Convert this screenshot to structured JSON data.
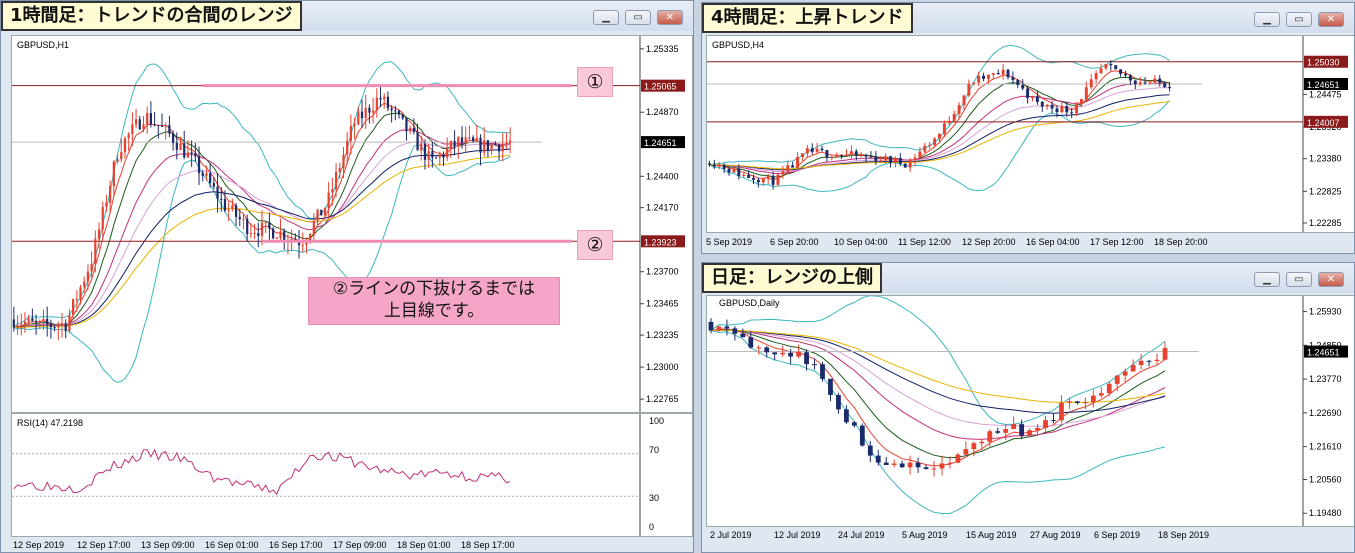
{
  "windows": {
    "h1": {
      "title": "1時間足：トレンドの合間のレンジ",
      "symbol": "GBPUSD,H1",
      "price_ticks": [
        "1.25335",
        "1.24870",
        "1.24400",
        "1.24170",
        "1.23700",
        "1.23465",
        "1.23235",
        "1.23000",
        "1.22765"
      ],
      "current_price": "1.24651",
      "level1": "1.25065",
      "level2": "1.23923",
      "marker1": "①",
      "marker2": "②",
      "note_line1": "②ラインの下抜けるまでは",
      "note_line2": "上目線です。",
      "time_labels": [
        "12 Sep 2019",
        "12 Sep 17:00",
        "13 Sep 09:00",
        "16 Sep 01:00",
        "16 Sep 17:00",
        "17 Sep 09:00",
        "18 Sep 01:00",
        "18 Sep 17:00"
      ],
      "rsi_label": "RSI(14) 47.2198",
      "rsi_ticks": [
        "100",
        "70",
        "30",
        "0"
      ]
    },
    "h4": {
      "title": "4時間足：上昇トレンド",
      "symbol": "GBPUSD,H4",
      "price_ticks": [
        "1.24475",
        "1.23920",
        "1.23380",
        "1.22825",
        "1.22285"
      ],
      "current_price": "1.24651",
      "level1": "1.25030",
      "level2": "1.24007",
      "time_labels": [
        "5 Sep 2019",
        "6 Sep 20:00",
        "10 Sep 04:00",
        "11 Sep 12:00",
        "12 Sep 20:00",
        "16 Sep 04:00",
        "17 Sep 12:00",
        "18 Sep 20:00"
      ]
    },
    "daily": {
      "title": "日足：レンジの上側",
      "symbol": "GBPUSD,Daily",
      "price_ticks": [
        "1.25930",
        "1.24850",
        "1.23770",
        "1.22690",
        "1.21610",
        "1.20560",
        "1.19480"
      ],
      "current_price": "1.24651",
      "time_labels": [
        "2 Jul 2019",
        "12 Jul 2019",
        "24 Jul 2019",
        "5 Aug 2019",
        "15 Aug 2019",
        "27 Aug 2019",
        "6 Sep 2019",
        "18 Sep 2019"
      ]
    }
  },
  "colors": {
    "bull": "#e8412f",
    "bear": "#1b2a6b",
    "level": "#8b1a1a",
    "pink_line": "#f08cb4",
    "bollinger": "#3cb7c0",
    "rsi": "#c0307a"
  },
  "chart_data": [
    {
      "type": "candlestick",
      "symbol": "GBPUSD",
      "timeframe": "H1",
      "ylim": [
        1.227,
        1.254
      ],
      "x": [
        "12 Sep 2019",
        "12 Sep 17:00",
        "13 Sep 09:00",
        "16 Sep 01:00",
        "16 Sep 17:00",
        "17 Sep 09:00",
        "18 Sep 01:00",
        "18 Sep 17:00"
      ],
      "close": [
        1.2335,
        1.233,
        1.2332,
        1.246,
        1.2485,
        1.2448,
        1.242,
        1.24,
        1.2392,
        1.2478,
        1.2498,
        1.247,
        1.245,
        1.2465,
        1.2462,
        1.2465
      ],
      "levels": [
        1.25065,
        1.23923
      ],
      "current": 1.24651
    },
    {
      "type": "line",
      "name": "RSI(14)",
      "ylim": [
        0,
        100
      ],
      "values": [
        42,
        40,
        38,
        58,
        70,
        66,
        48,
        40,
        35,
        70,
        65,
        55,
        50,
        52,
        48,
        47.2198
      ],
      "levels": [
        70,
        30
      ]
    },
    {
      "type": "candlestick",
      "symbol": "GBPUSD",
      "timeframe": "H4",
      "ylim": [
        1.222,
        1.254
      ],
      "x": [
        "5 Sep 2019",
        "6 Sep 20:00",
        "10 Sep 04:00",
        "11 Sep 12:00",
        "12 Sep 20:00",
        "16 Sep 04:00",
        "17 Sep 12:00",
        "18 Sep 20:00"
      ],
      "close": [
        1.2335,
        1.231,
        1.23,
        1.235,
        1.2345,
        1.234,
        1.233,
        1.238,
        1.247,
        1.2485,
        1.243,
        1.242,
        1.2495,
        1.247,
        1.2465
      ],
      "levels": [
        1.2503,
        1.24007
      ],
      "current": 1.24651
    },
    {
      "type": "candlestick",
      "symbol": "GBPUSD",
      "timeframe": "Daily",
      "ylim": [
        1.192,
        1.263
      ],
      "x": [
        "2 Jul 2019",
        "12 Jul 2019",
        "24 Jul 2019",
        "5 Aug 2019",
        "15 Aug 2019",
        "27 Aug 2019",
        "6 Sep 2019",
        "18 Sep 2019"
      ],
      "close": [
        1.255,
        1.25,
        1.247,
        1.244,
        1.228,
        1.213,
        1.21,
        1.209,
        1.215,
        1.223,
        1.22,
        1.231,
        1.232,
        1.243,
        1.2465
      ],
      "current": 1.24651
    }
  ]
}
